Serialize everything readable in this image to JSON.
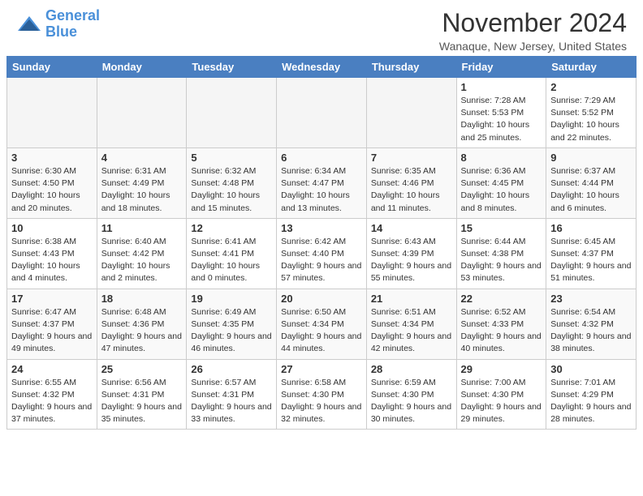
{
  "header": {
    "logo_line1": "General",
    "logo_line2": "Blue",
    "title": "November 2024",
    "location": "Wanaque, New Jersey, United States"
  },
  "weekdays": [
    "Sunday",
    "Monday",
    "Tuesday",
    "Wednesday",
    "Thursday",
    "Friday",
    "Saturday"
  ],
  "weeks": [
    [
      {
        "day": "",
        "info": ""
      },
      {
        "day": "",
        "info": ""
      },
      {
        "day": "",
        "info": ""
      },
      {
        "day": "",
        "info": ""
      },
      {
        "day": "",
        "info": ""
      },
      {
        "day": "1",
        "info": "Sunrise: 7:28 AM\nSunset: 5:53 PM\nDaylight: 10 hours and 25 minutes."
      },
      {
        "day": "2",
        "info": "Sunrise: 7:29 AM\nSunset: 5:52 PM\nDaylight: 10 hours and 22 minutes."
      }
    ],
    [
      {
        "day": "3",
        "info": "Sunrise: 6:30 AM\nSunset: 4:50 PM\nDaylight: 10 hours and 20 minutes."
      },
      {
        "day": "4",
        "info": "Sunrise: 6:31 AM\nSunset: 4:49 PM\nDaylight: 10 hours and 18 minutes."
      },
      {
        "day": "5",
        "info": "Sunrise: 6:32 AM\nSunset: 4:48 PM\nDaylight: 10 hours and 15 minutes."
      },
      {
        "day": "6",
        "info": "Sunrise: 6:34 AM\nSunset: 4:47 PM\nDaylight: 10 hours and 13 minutes."
      },
      {
        "day": "7",
        "info": "Sunrise: 6:35 AM\nSunset: 4:46 PM\nDaylight: 10 hours and 11 minutes."
      },
      {
        "day": "8",
        "info": "Sunrise: 6:36 AM\nSunset: 4:45 PM\nDaylight: 10 hours and 8 minutes."
      },
      {
        "day": "9",
        "info": "Sunrise: 6:37 AM\nSunset: 4:44 PM\nDaylight: 10 hours and 6 minutes."
      }
    ],
    [
      {
        "day": "10",
        "info": "Sunrise: 6:38 AM\nSunset: 4:43 PM\nDaylight: 10 hours and 4 minutes."
      },
      {
        "day": "11",
        "info": "Sunrise: 6:40 AM\nSunset: 4:42 PM\nDaylight: 10 hours and 2 minutes."
      },
      {
        "day": "12",
        "info": "Sunrise: 6:41 AM\nSunset: 4:41 PM\nDaylight: 10 hours and 0 minutes."
      },
      {
        "day": "13",
        "info": "Sunrise: 6:42 AM\nSunset: 4:40 PM\nDaylight: 9 hours and 57 minutes."
      },
      {
        "day": "14",
        "info": "Sunrise: 6:43 AM\nSunset: 4:39 PM\nDaylight: 9 hours and 55 minutes."
      },
      {
        "day": "15",
        "info": "Sunrise: 6:44 AM\nSunset: 4:38 PM\nDaylight: 9 hours and 53 minutes."
      },
      {
        "day": "16",
        "info": "Sunrise: 6:45 AM\nSunset: 4:37 PM\nDaylight: 9 hours and 51 minutes."
      }
    ],
    [
      {
        "day": "17",
        "info": "Sunrise: 6:47 AM\nSunset: 4:37 PM\nDaylight: 9 hours and 49 minutes."
      },
      {
        "day": "18",
        "info": "Sunrise: 6:48 AM\nSunset: 4:36 PM\nDaylight: 9 hours and 47 minutes."
      },
      {
        "day": "19",
        "info": "Sunrise: 6:49 AM\nSunset: 4:35 PM\nDaylight: 9 hours and 46 minutes."
      },
      {
        "day": "20",
        "info": "Sunrise: 6:50 AM\nSunset: 4:34 PM\nDaylight: 9 hours and 44 minutes."
      },
      {
        "day": "21",
        "info": "Sunrise: 6:51 AM\nSunset: 4:34 PM\nDaylight: 9 hours and 42 minutes."
      },
      {
        "day": "22",
        "info": "Sunrise: 6:52 AM\nSunset: 4:33 PM\nDaylight: 9 hours and 40 minutes."
      },
      {
        "day": "23",
        "info": "Sunrise: 6:54 AM\nSunset: 4:32 PM\nDaylight: 9 hours and 38 minutes."
      }
    ],
    [
      {
        "day": "24",
        "info": "Sunrise: 6:55 AM\nSunset: 4:32 PM\nDaylight: 9 hours and 37 minutes."
      },
      {
        "day": "25",
        "info": "Sunrise: 6:56 AM\nSunset: 4:31 PM\nDaylight: 9 hours and 35 minutes."
      },
      {
        "day": "26",
        "info": "Sunrise: 6:57 AM\nSunset: 4:31 PM\nDaylight: 9 hours and 33 minutes."
      },
      {
        "day": "27",
        "info": "Sunrise: 6:58 AM\nSunset: 4:30 PM\nDaylight: 9 hours and 32 minutes."
      },
      {
        "day": "28",
        "info": "Sunrise: 6:59 AM\nSunset: 4:30 PM\nDaylight: 9 hours and 30 minutes."
      },
      {
        "day": "29",
        "info": "Sunrise: 7:00 AM\nSunset: 4:30 PM\nDaylight: 9 hours and 29 minutes."
      },
      {
        "day": "30",
        "info": "Sunrise: 7:01 AM\nSunset: 4:29 PM\nDaylight: 9 hours and 28 minutes."
      }
    ]
  ]
}
